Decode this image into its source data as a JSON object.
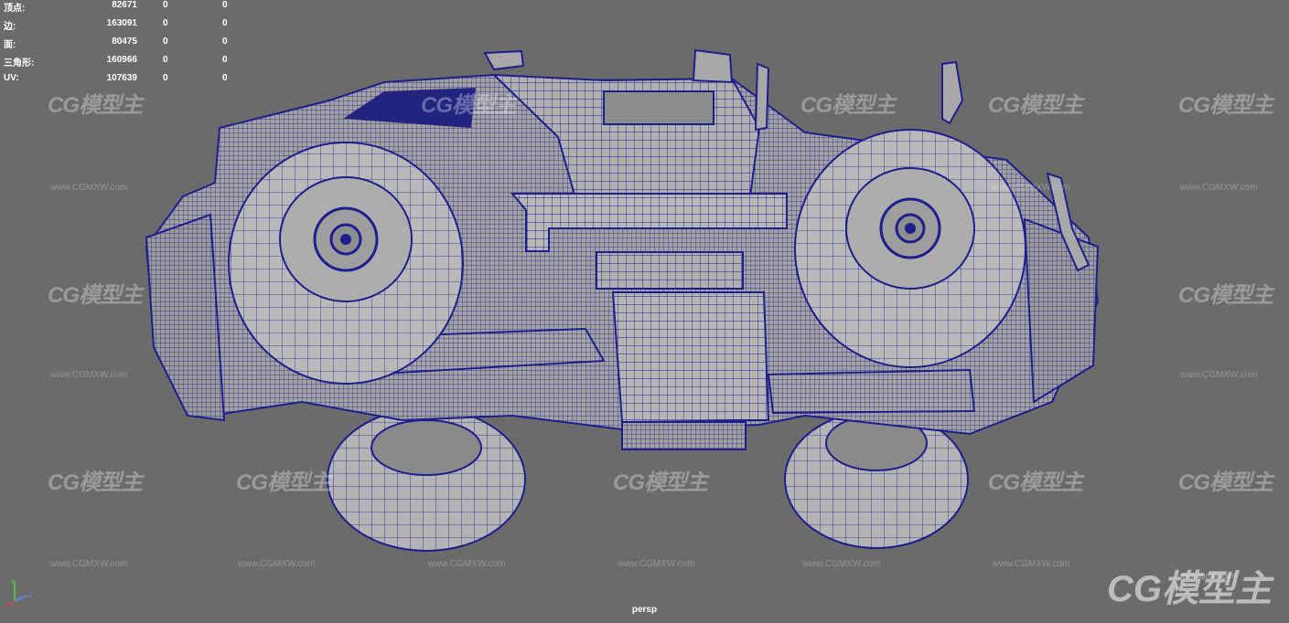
{
  "stats": {
    "rows": [
      {
        "label": "顶点:",
        "v1": "82671",
        "v2": "0",
        "v3": "0"
      },
      {
        "label": "边:",
        "v1": "163091",
        "v2": "0",
        "v3": "0"
      },
      {
        "label": "面:",
        "v1": "80475",
        "v2": "0",
        "v3": "0"
      },
      {
        "label": "三角形:",
        "v1": "160966",
        "v2": "0",
        "v3": "0"
      },
      {
        "label": "UV:",
        "v1": "107639",
        "v2": "0",
        "v3": "0"
      }
    ]
  },
  "camera": {
    "name": "persp"
  },
  "watermark": {
    "logo": "CG模型主",
    "url": "www.CGMXW.com"
  },
  "corner": {
    "logo": "CG模型主",
    "url": "www.cgmxw.com"
  },
  "colors": {
    "background": "#6b6b6b",
    "wireframe": "#1e1e8c",
    "mesh_fill": "#a9a9a9"
  }
}
